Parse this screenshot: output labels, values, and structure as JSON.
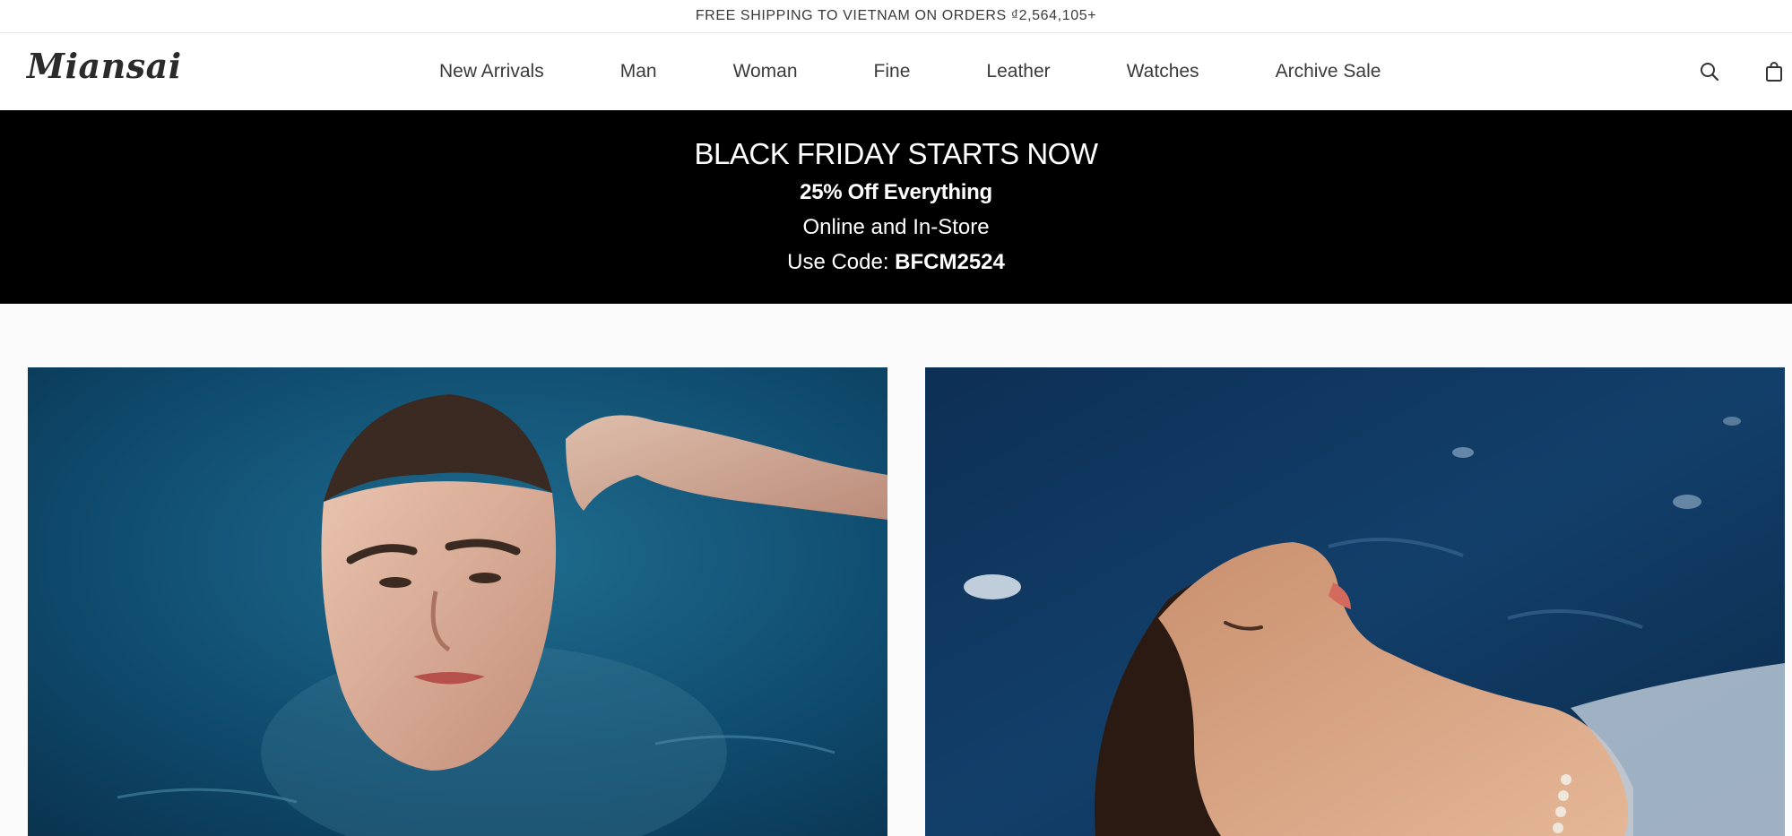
{
  "announcement": {
    "text": "FREE SHIPPING TO VIETNAM ON ORDERS ₫2,564,105+"
  },
  "header": {
    "logo": "Miansai",
    "nav": [
      {
        "label": "New Arrivals"
      },
      {
        "label": "Man"
      },
      {
        "label": "Woman"
      },
      {
        "label": "Fine"
      },
      {
        "label": "Leather"
      },
      {
        "label": "Watches"
      },
      {
        "label": "Archive Sale"
      }
    ],
    "icons": [
      "search-icon",
      "shopping-bag-icon"
    ]
  },
  "promo": {
    "title": "BLACK FRIDAY STARTS NOW",
    "subtitle": "25% Off Everything",
    "line": "Online and In-Store",
    "code_prefix": "Use Code: ",
    "code": "BFCM2524"
  },
  "colors": {
    "promo_bg": "#000000",
    "promo_text": "#ffffff",
    "water_blue": "#0f4b6e",
    "page_bg": "#fbfbfb"
  }
}
